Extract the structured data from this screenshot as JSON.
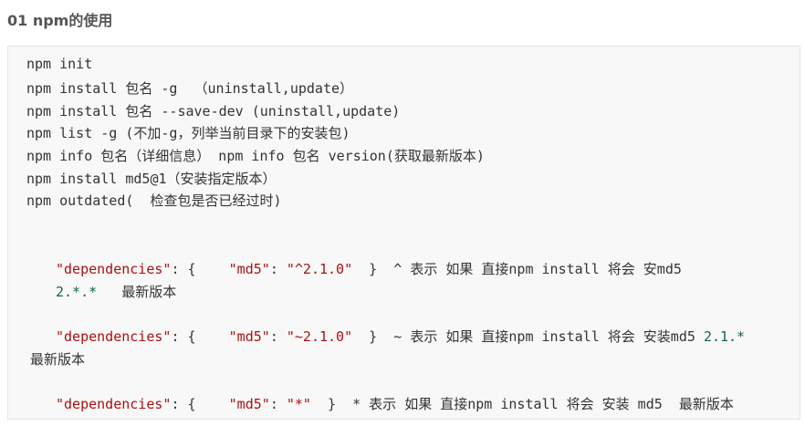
{
  "heading": "01 npm的使用",
  "code_lines": [
    "npm init",
    "npm install 包名 -g  （uninstall,update）",
    "npm install 包名 --save-dev (uninstall,update)",
    "npm list -g (不加-g，列举当前目录下的安装包)",
    "npm info 包名（详细信息） npm info 包名 version(获取最新版本)",
    "npm install md5@1（安装指定版本）",
    "npm outdated(  检查包是否已经过时)"
  ],
  "dep1": {
    "key": "\"dependencies\"",
    "colon_open": ": {    ",
    "md5_key": "\"md5\"",
    "colon": ": ",
    "value": "\"^2.1.0\"",
    "close": "  }",
    "note": "  ^ 表示 如果 直接npm install 将会 安md5",
    "cont_version": "2.*.*",
    "cont_note": "   最新版本"
  },
  "dep2": {
    "key": "\"dependencies\"",
    "colon_open": ": {    ",
    "md5_key": "\"md5\"",
    "colon": ": ",
    "value": "\"~2.1.0\"",
    "close": "  }",
    "note": "  ~ 表示 如果 直接npm install 将会 安装md5 ",
    "version": "2.1.*",
    "cont_note": "最新版本"
  },
  "dep3": {
    "key": "\"dependencies\"",
    "colon_open": ": {    ",
    "md5_key": "\"md5\"",
    "colon": ": ",
    "value": "\"*\"",
    "close": "  }",
    "note": "  * 表示 如果 直接npm install 将会 安装 md5  最新版本"
  }
}
